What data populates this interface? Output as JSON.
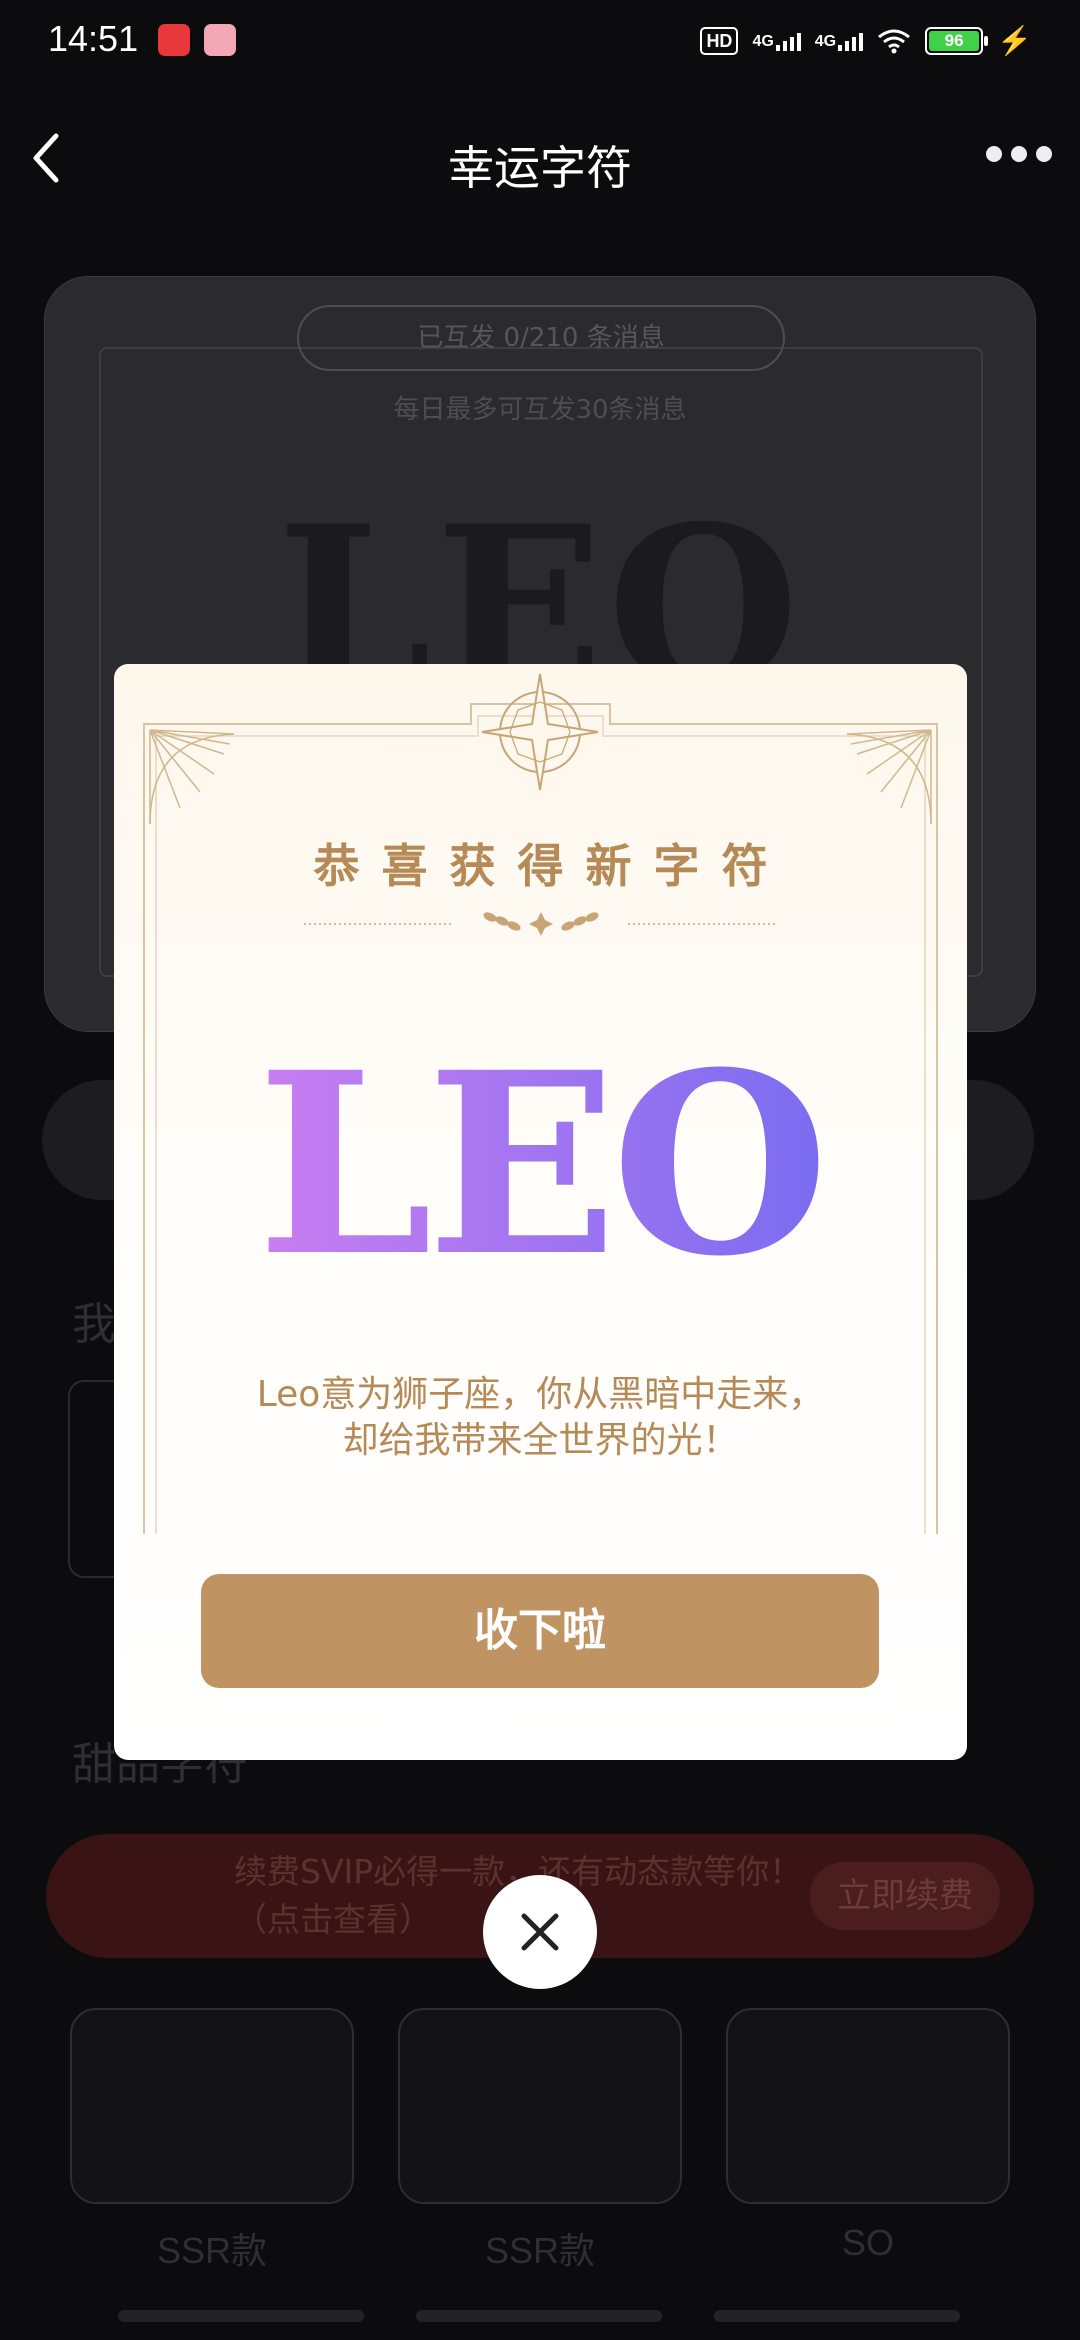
{
  "status_bar": {
    "time": "14:51",
    "hd": "HD",
    "net1": "4G",
    "net2": "4G",
    "battery": "96"
  },
  "header": {
    "title": "幸运字符"
  },
  "background": {
    "sent_counter": "已互发 0/210 条消息",
    "daily_limit": "每日最多可互发30条消息",
    "big_word": "LEO",
    "section_label": "我",
    "dessert_label": "甜品字符",
    "svip_text": "续费SVIP必得一款，还有动态款等你！（点击查看）",
    "renew_label": "立即续费",
    "stickers": [
      {
        "label": "SSR款"
      },
      {
        "label": "SSR款"
      },
      {
        "label": "SO"
      }
    ]
  },
  "modal": {
    "title": "恭喜获得新字符",
    "word": "LEO",
    "description_line1": "Leo意为狮子座，你从黑暗中走来，",
    "description_line2": "却给我带来全世界的光！",
    "button_label": "收下啦"
  },
  "colors": {
    "accent_gold": "#b68a57",
    "button": "#bf9462",
    "leo_gradient_start": "#c97ef0",
    "leo_gradient_end": "#7a6cf0"
  }
}
